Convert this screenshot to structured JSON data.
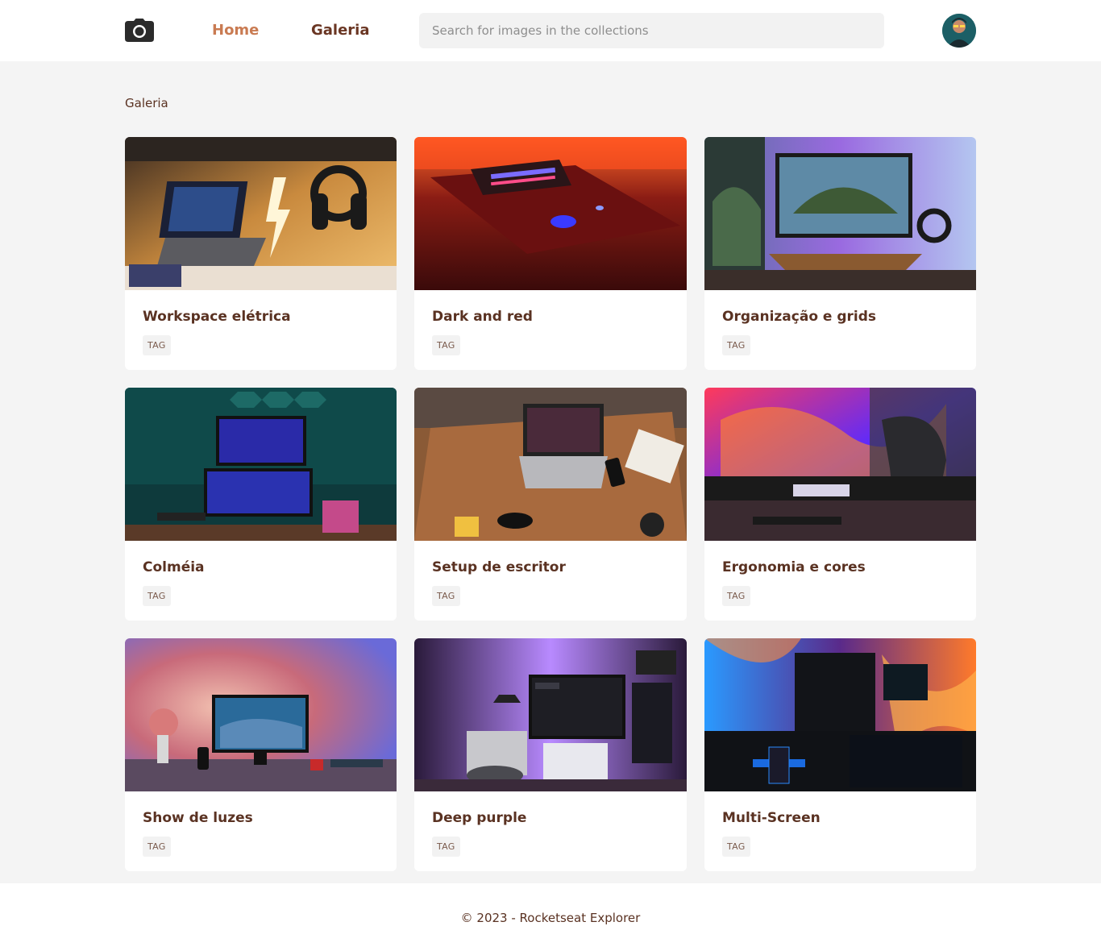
{
  "header": {
    "home_label": "Home",
    "gallery_label": "Galeria",
    "search_placeholder": "Search for images in the collections"
  },
  "icons": {
    "logo": "camera-icon",
    "avatar": "user-avatar"
  },
  "colors": {
    "nav_active": "#c97b52",
    "text_primary": "#5a3222",
    "background": "#f4f4f4"
  },
  "gallery": {
    "title": "Galeria",
    "cards": [
      {
        "title": "Workspace elétrica",
        "tag": "TAG"
      },
      {
        "title": "Dark and red",
        "tag": "TAG"
      },
      {
        "title": "Organização e grids",
        "tag": "TAG"
      },
      {
        "title": "Colméia",
        "tag": "TAG"
      },
      {
        "title": "Setup de escritor",
        "tag": "TAG"
      },
      {
        "title": "Ergonomia e cores",
        "tag": "TAG"
      },
      {
        "title": "Show de luzes",
        "tag": "TAG"
      },
      {
        "title": "Deep purple",
        "tag": "TAG"
      },
      {
        "title": "Multi-Screen",
        "tag": "TAG"
      }
    ]
  },
  "footer": {
    "text": "© 2023 - Rocketseat Explorer"
  }
}
